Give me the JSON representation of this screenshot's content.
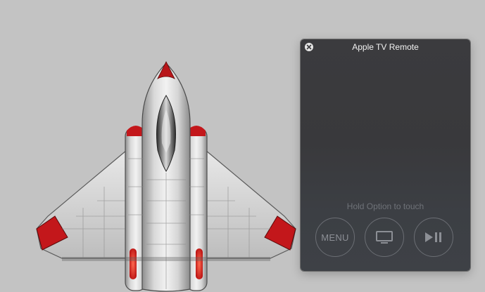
{
  "window": {
    "title": "Apple TV Remote",
    "hint": "Hold Option to touch"
  },
  "buttons": {
    "close_icon": "close-icon",
    "menu_label": "MENU",
    "tv_icon": "tv-icon",
    "playpause_icon": "play-pause-icon"
  },
  "background": {
    "image": "spaceship-illustration"
  },
  "colors": {
    "desktop": "#c3c3c3",
    "window": "#3a3a3d",
    "accent_red": "#c8171a"
  }
}
